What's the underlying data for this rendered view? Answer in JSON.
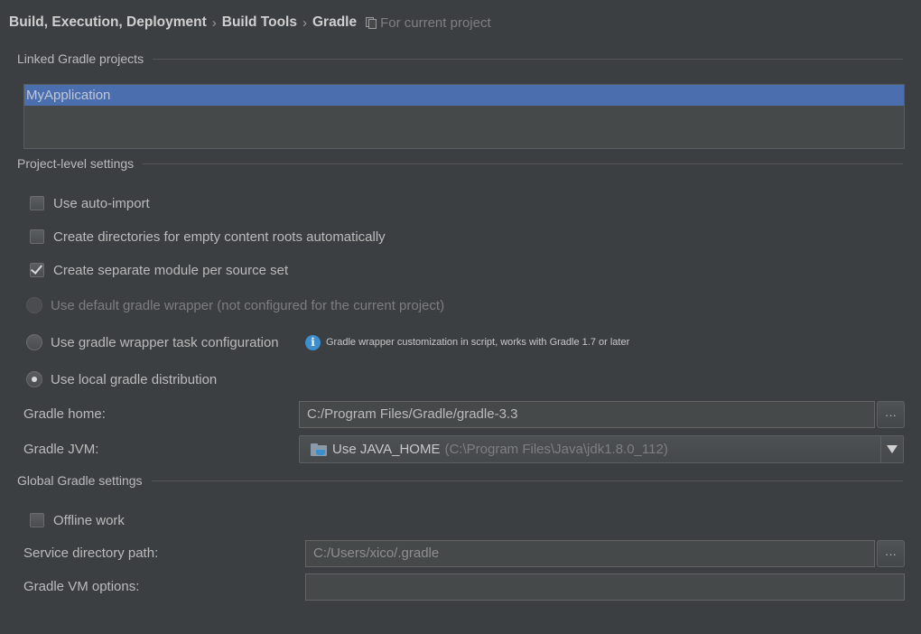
{
  "breadcrumb": {
    "parts": [
      "Build, Execution, Deployment",
      "Build Tools",
      "Gradle"
    ],
    "separator": "›",
    "scope_icon": "project-scope-icon",
    "scope_label": "For current project"
  },
  "linked_projects": {
    "title": "Linked Gradle projects",
    "items": [
      "MyApplication"
    ],
    "selected_index": 0
  },
  "project_settings": {
    "title": "Project-level settings",
    "checkboxes": [
      {
        "label": "Use auto-import",
        "checked": false
      },
      {
        "label": "Create directories for empty content roots automatically",
        "checked": false
      },
      {
        "label": "Create separate module per source set",
        "checked": true
      }
    ],
    "radios": [
      {
        "label": "Use default gradle wrapper (not configured for the current project)",
        "selected": false,
        "enabled": false
      },
      {
        "label": "Use gradle wrapper task configuration",
        "selected": false,
        "enabled": true
      },
      {
        "label": "Use local gradle distribution",
        "selected": true,
        "enabled": true
      }
    ],
    "wrapper_hint": "Gradle wrapper customization in script, works with Gradle 1.7 or later",
    "gradle_home_label": "Gradle home:",
    "gradle_home_value": "C:/Program Files/Gradle/gradle-3.3",
    "gradle_jvm_label": "Gradle JVM:",
    "gradle_jvm_value": "Use JAVA_HOME",
    "gradle_jvm_detail": "(C:\\Program Files\\Java\\jdk1.8.0_112)",
    "browse_label": "···"
  },
  "global_settings": {
    "title": "Global Gradle settings",
    "offline_label": "Offline work",
    "offline_checked": false,
    "service_dir_label": "Service directory path:",
    "service_dir_value": "C:/Users/xico/.gradle",
    "vm_options_label": "Gradle VM options:",
    "vm_options_value": "",
    "browse_label": "···"
  },
  "colors": {
    "background": "#3c3f41",
    "selection": "#4b6eaf",
    "info_accent": "#3a8fcc"
  }
}
